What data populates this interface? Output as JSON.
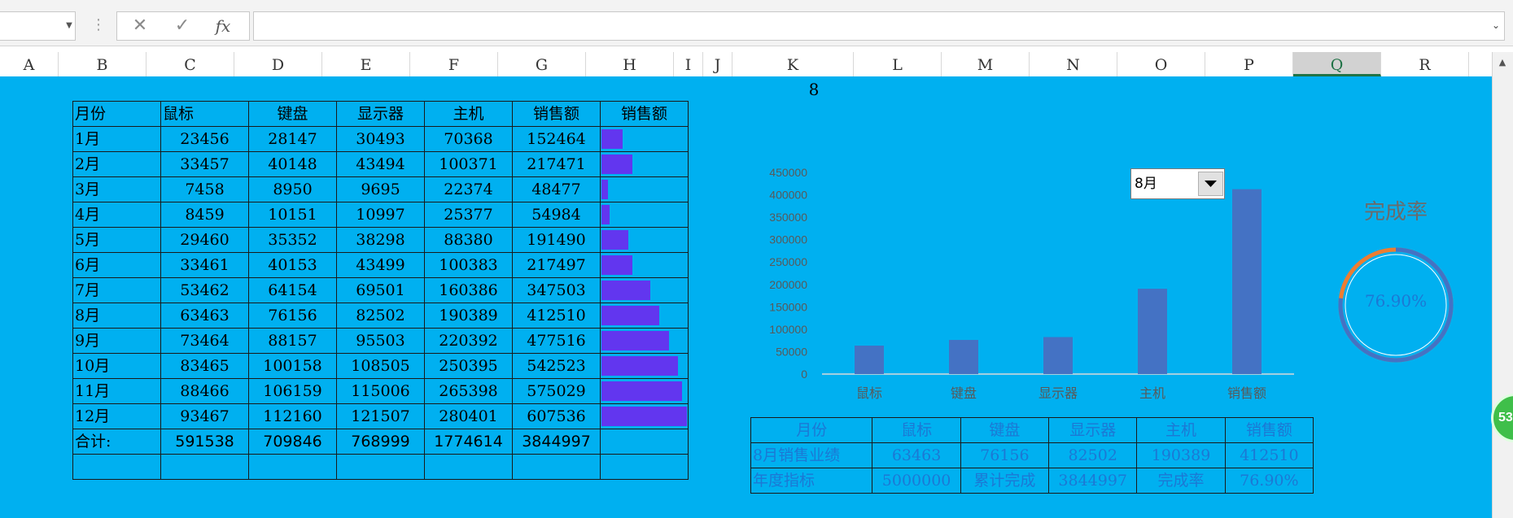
{
  "formula_bar": {
    "name_box": "",
    "cancel_glyph": "✕",
    "enter_glyph": "✓",
    "fx_label": "fx",
    "formula": ""
  },
  "columns": [
    "A",
    "B",
    "C",
    "D",
    "E",
    "F",
    "G",
    "H",
    "I",
    "J",
    "K",
    "L",
    "M",
    "N",
    "O",
    "P",
    "Q",
    "R"
  ],
  "selected_column": "Q",
  "cell_k1": "8",
  "main_table": {
    "header": [
      "月份",
      "鼠标",
      "键盘",
      "显示器",
      "主机",
      "销售额",
      "销售额"
    ],
    "rows": [
      {
        "month": "1月",
        "mouse": "23456",
        "keyboard": "28147",
        "monitor": "30493",
        "host": "70368",
        "sales": "152464",
        "bar": 0.251
      },
      {
        "month": "2月",
        "mouse": "33457",
        "keyboard": "40148",
        "monitor": "43494",
        "host": "100371",
        "sales": "217471",
        "bar": 0.358
      },
      {
        "month": "3月",
        "mouse": "7458",
        "keyboard": "8950",
        "monitor": "9695",
        "host": "22374",
        "sales": "48477",
        "bar": 0.0798
      },
      {
        "month": "4月",
        "mouse": "8459",
        "keyboard": "10151",
        "monitor": "10997",
        "host": "25377",
        "sales": "54984",
        "bar": 0.0905
      },
      {
        "month": "5月",
        "mouse": "29460",
        "keyboard": "35352",
        "monitor": "38298",
        "host": "88380",
        "sales": "191490",
        "bar": 0.3153
      },
      {
        "month": "6月",
        "mouse": "33461",
        "keyboard": "40153",
        "monitor": "43499",
        "host": "100383",
        "sales": "217497",
        "bar": 0.3581
      },
      {
        "month": "7月",
        "mouse": "53462",
        "keyboard": "64154",
        "monitor": "69501",
        "host": "160386",
        "sales": "347503",
        "bar": 0.5721
      },
      {
        "month": "8月",
        "mouse": "63463",
        "keyboard": "76156",
        "monitor": "82502",
        "host": "190389",
        "sales": "412510",
        "bar": 0.6791
      },
      {
        "month": "9月",
        "mouse": "73464",
        "keyboard": "88157",
        "monitor": "95503",
        "host": "220392",
        "sales": "477516",
        "bar": 0.7861
      },
      {
        "month": "10月",
        "mouse": "83465",
        "keyboard": "100158",
        "monitor": "108505",
        "host": "250395",
        "sales": "542523",
        "bar": 0.8932
      },
      {
        "month": "11月",
        "mouse": "88466",
        "keyboard": "106159",
        "monitor": "115006",
        "host": "265398",
        "sales": "575029",
        "bar": 0.9467
      },
      {
        "month": "12月",
        "mouse": "93467",
        "keyboard": "112160",
        "monitor": "121507",
        "host": "280401",
        "sales": "607536",
        "bar": 1.0
      }
    ],
    "total": {
      "label": "合计:",
      "mouse": "591538",
      "keyboard": "709846",
      "monitor": "768999",
      "host": "1774614",
      "sales": "3844997"
    }
  },
  "dropdown": {
    "selected": "8月"
  },
  "chart_data": {
    "type": "bar",
    "categories": [
      "鼠标",
      "键盘",
      "显示器",
      "主机",
      "销售额"
    ],
    "values": [
      63463,
      76156,
      82502,
      190389,
      412510
    ],
    "ylim": [
      0,
      450000
    ],
    "yticks": [
      "0",
      "50000",
      "100000",
      "150000",
      "200000",
      "250000",
      "300000",
      "350000",
      "400000",
      "450000"
    ],
    "bar_color": "#4472c4",
    "grid": false
  },
  "summary": {
    "header": [
      "月份",
      "鼠标",
      "键盘",
      "显示器",
      "主机",
      "销售额"
    ],
    "row1": [
      "8月销售业绩",
      "63463",
      "76156",
      "82502",
      "190389",
      "412510"
    ],
    "row2": [
      "年度指标",
      "5000000",
      "累计完成",
      "3844997",
      "完成率",
      "76.90%"
    ]
  },
  "donut": {
    "title": "完成率",
    "label": "76.90%",
    "value": 0.769,
    "main_color": "#4472c4",
    "rest_color": "#ed7d31"
  },
  "badge": "53",
  "colors": {
    "sheet_bg": "#00b0f0",
    "databar": "#6236ef",
    "selected_col": "#217346"
  }
}
